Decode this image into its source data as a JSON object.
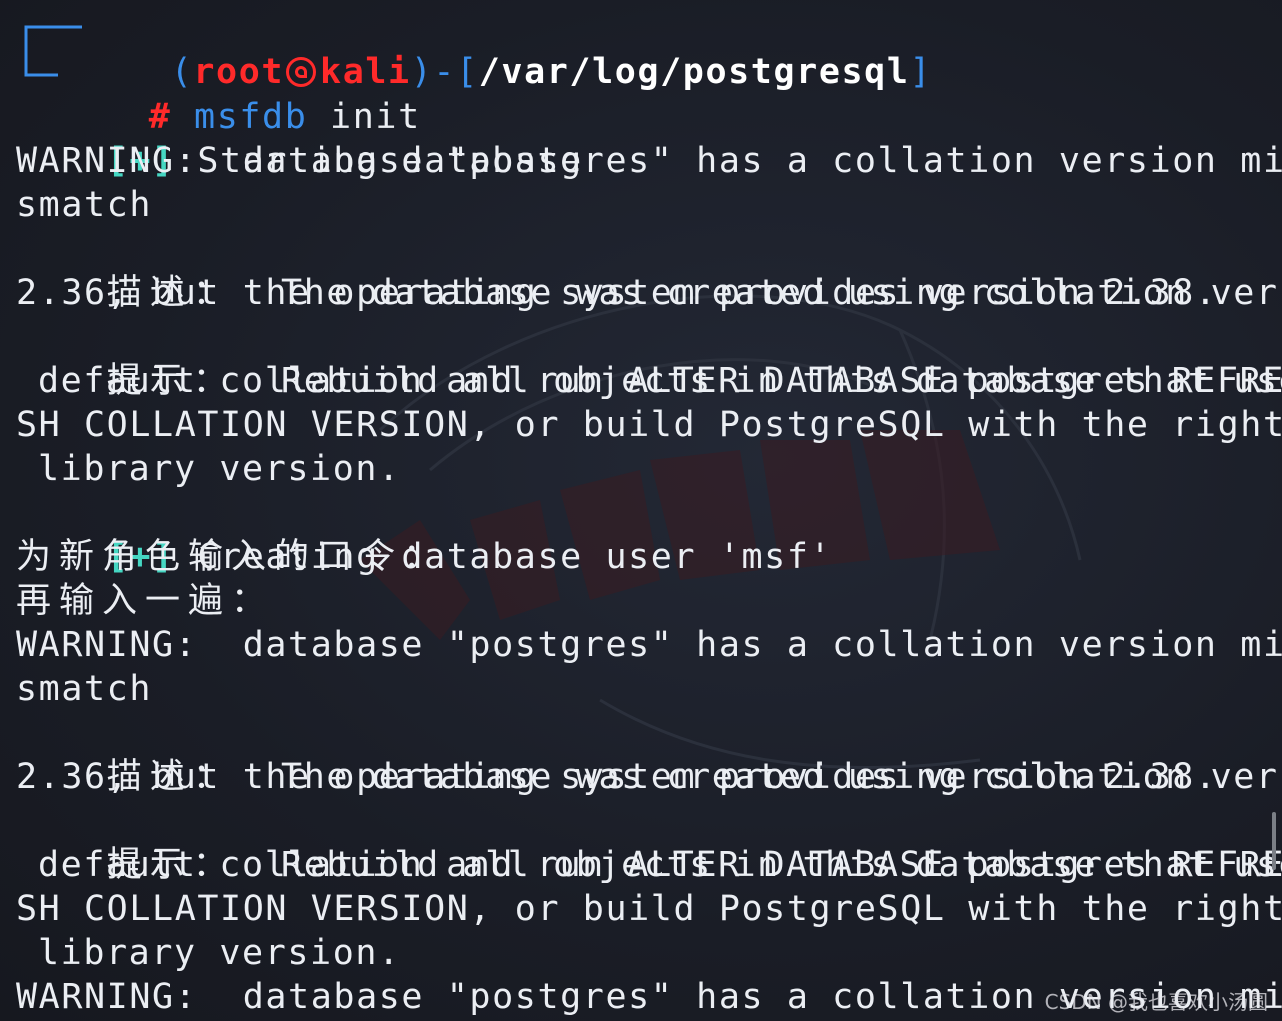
{
  "prompt": {
    "open_paren": "(",
    "user": "root",
    "host": "kali",
    "close_sep": ")-[",
    "path": "/var/log/postgresql",
    "close_bracket": "]",
    "hash": "#",
    "command_name": "msfdb",
    "command_args": " init"
  },
  "output": {
    "status1_tag": "[+]",
    "status1_text": " Starting database",
    "warn1_a": "WARNING:  database \"postgres\" has a collation version mi",
    "warn1_b": "smatch",
    "detail1_label": "描述：",
    "detail1_a": "  The database was created using collation version",
    "detail1_b": "2.36, but the operating system provides version 2.38.",
    "hint1_label": "提示：",
    "hint1_a": "  Rebuild all objects in this database that use the",
    "hint1_b": "default collation and run ALTER DATABASE postgres REFRE",
    "hint1_c": "SH COLLATION VERSION, or build PostgreSQL with the right",
    "hint1_d": "library version.",
    "status2_tag": "[+]",
    "status2_text": " Creating database user 'msf'",
    "pw_prompt1": "为新角色输入的口令：",
    "pw_prompt2": "再输入一遍：",
    "warn2_a": "WARNING:  database \"postgres\" has a collation version mi",
    "warn2_b": "smatch",
    "detail2_label": "描述：",
    "detail2_a": "  The database was created using collation version",
    "detail2_b": "2.36, but the operating system provides version 2.38.",
    "hint2_label": "提示：",
    "hint2_a": "  Rebuild all objects in this database that use the",
    "hint2_b": "default collation and run ALTER DATABASE postgres REFRE",
    "hint2_c": "SH COLLATION VERSION, or build PostgreSQL with the right",
    "hint2_d": "library version.",
    "warn3_a": "WARNING:  database \"postgres\" has a collation version mi"
  },
  "watermark": "CSDN @我也喜欢小汤圆",
  "colors": {
    "background": "#1b1f29",
    "text": "#ebeef3",
    "prompt_blue": "#3a8eea",
    "prompt_red": "#ff2a2a",
    "status_green": "#45d7c3"
  }
}
